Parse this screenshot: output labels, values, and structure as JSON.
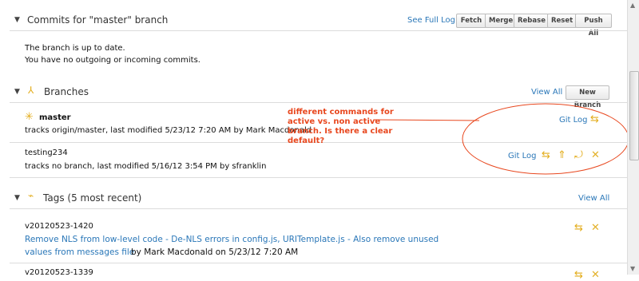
{
  "commits": {
    "title": "Commits for \"master\" branch",
    "see_full_log": "See Full Log",
    "buttons": [
      "Fetch",
      "Merge",
      "Rebase",
      "Reset",
      "Push All"
    ],
    "status_line1": "The branch is up to date.",
    "status_line2": "You have no outgoing or incoming commits."
  },
  "branches": {
    "title": "Branches",
    "view_all": "View All",
    "new_branch": "New Branch",
    "items": [
      {
        "name": "master",
        "detail": "tracks origin/master, last modified 5/23/12 7:20 AM by Mark Macdonald",
        "git_log": "Git Log"
      },
      {
        "name": "testing234",
        "detail": "tracks no branch, last modified 5/16/12 3:54 PM by sfranklin",
        "git_log": "Git Log"
      }
    ]
  },
  "annotation": {
    "text": "different commands for active vs. non active branch.  Is there a clear default?"
  },
  "tags": {
    "title": "Tags (5 most recent)",
    "view_all": "View All",
    "items": [
      {
        "name": "v20120523-1420",
        "message_line1": "Remove NLS from low-level code - De-NLS errors in config.js, URITemplate.js - Also remove unused",
        "message_line2": "values from messages file",
        "by": "by Mark Macdonald on 5/23/12 7:20 AM"
      },
      {
        "name": "v20120523-1339"
      }
    ]
  },
  "colors": {
    "link": "#2a77b8",
    "annotation": "#e8471e",
    "icon": "#e3ad1c"
  }
}
